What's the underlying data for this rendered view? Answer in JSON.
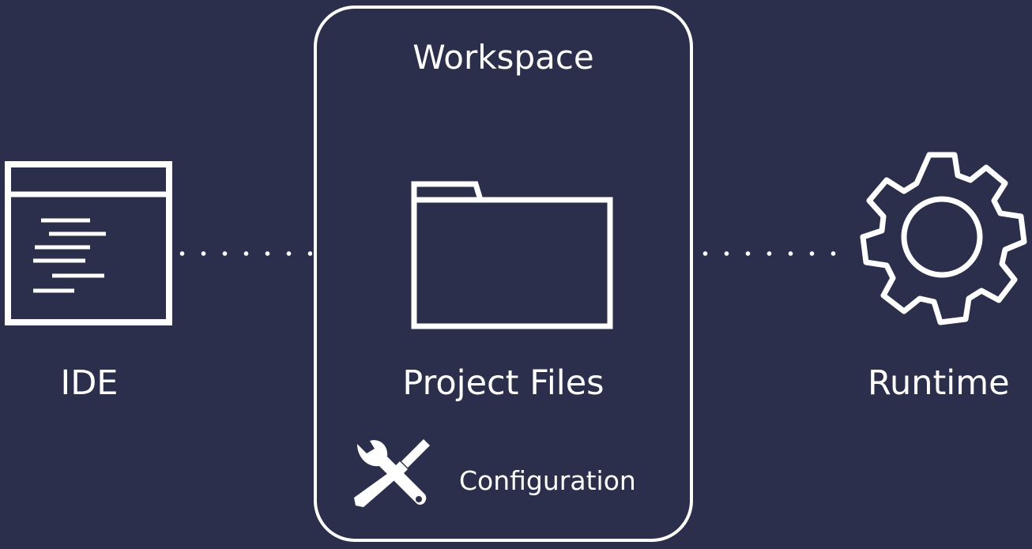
{
  "diagram": {
    "background_color": "#2b2f4b",
    "stroke_color": "#ffffff",
    "nodes": {
      "ide": {
        "label": "IDE",
        "icon": "code-editor-window-icon"
      },
      "workspace": {
        "title": "Workspace",
        "content_label": "Project Files",
        "content_icon": "folder-icon",
        "config_label": "Configuration",
        "config_icon": "wrench-screwdriver-icon"
      },
      "runtime": {
        "label": "Runtime",
        "icon": "gear-icon"
      }
    },
    "connectors": [
      {
        "from": "ide",
        "to": "workspace",
        "style": "dotted"
      },
      {
        "from": "workspace",
        "to": "runtime",
        "style": "dotted"
      }
    ]
  }
}
